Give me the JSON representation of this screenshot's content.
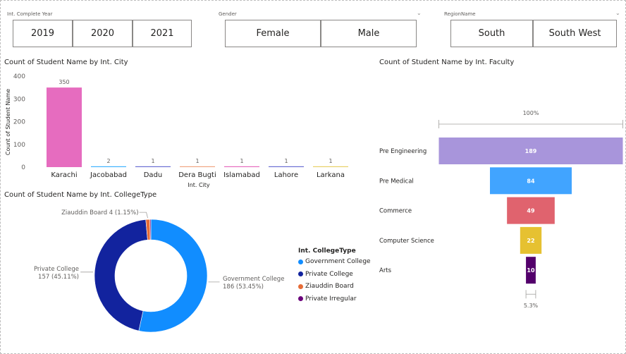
{
  "slicers": {
    "year": {
      "title": "Int. Complete Year",
      "options": [
        "2019",
        "2020",
        "2021"
      ]
    },
    "gender": {
      "title": "Gender",
      "options": [
        "Female",
        "Male"
      ]
    },
    "region": {
      "title": "RegionName",
      "options": [
        "South",
        "South West"
      ]
    }
  },
  "chart_data": [
    {
      "type": "bar",
      "title": "Count of Student Name by Int. City",
      "xlabel": "Int. City",
      "ylabel": "Count of Student Name",
      "ylim": [
        0,
        400
      ],
      "yticks": [
        0,
        100,
        200,
        300,
        400
      ],
      "grid": false,
      "categories": [
        "Karachi",
        "Jacobabad",
        "Dadu",
        "Dera Bugti",
        "Islamabad",
        "Lahore",
        "Larkana"
      ],
      "values": [
        350,
        2,
        1,
        1,
        1,
        1,
        1
      ],
      "colors": [
        "#e66cbf",
        "#41b4ff",
        "#6b6fd4",
        "#f0a582",
        "#e66cbf",
        "#6b6fd4",
        "#e8d166"
      ]
    },
    {
      "type": "pie",
      "title": "Count of Student Name by Int. CollegeType",
      "legend_title": "Int. CollegeType",
      "legend_position": "right",
      "categories": [
        "Government College",
        "Private College",
        "Ziauddin Board",
        "Private Irregular"
      ],
      "values": [
        186,
        157,
        4,
        1
      ],
      "colors": [
        "#118dff",
        "#12239e",
        "#e66c37",
        "#6b007b"
      ],
      "labels": [
        {
          "line1": "Government College",
          "line2": "186 (53.45%)"
        },
        {
          "line1": "Private College",
          "line2": "157 (45.11%)"
        },
        {
          "line1": "Ziauddin Board 4 (1.15%)",
          "line2": ""
        }
      ]
    },
    {
      "type": "bar",
      "subtype": "funnel",
      "title": "Count of Student Name by Int. Faculty",
      "categories": [
        "Pre Engineering",
        "Pre Medical",
        "Commerce",
        "Computer Science",
        "Arts"
      ],
      "values": [
        189,
        84,
        49,
        22,
        10
      ],
      "colors": [
        "#a895db",
        "#41a4ff",
        "#e0636e",
        "#e6c131",
        "#53006b"
      ],
      "top_label": "100%",
      "bottom_label": "5.3%"
    }
  ]
}
